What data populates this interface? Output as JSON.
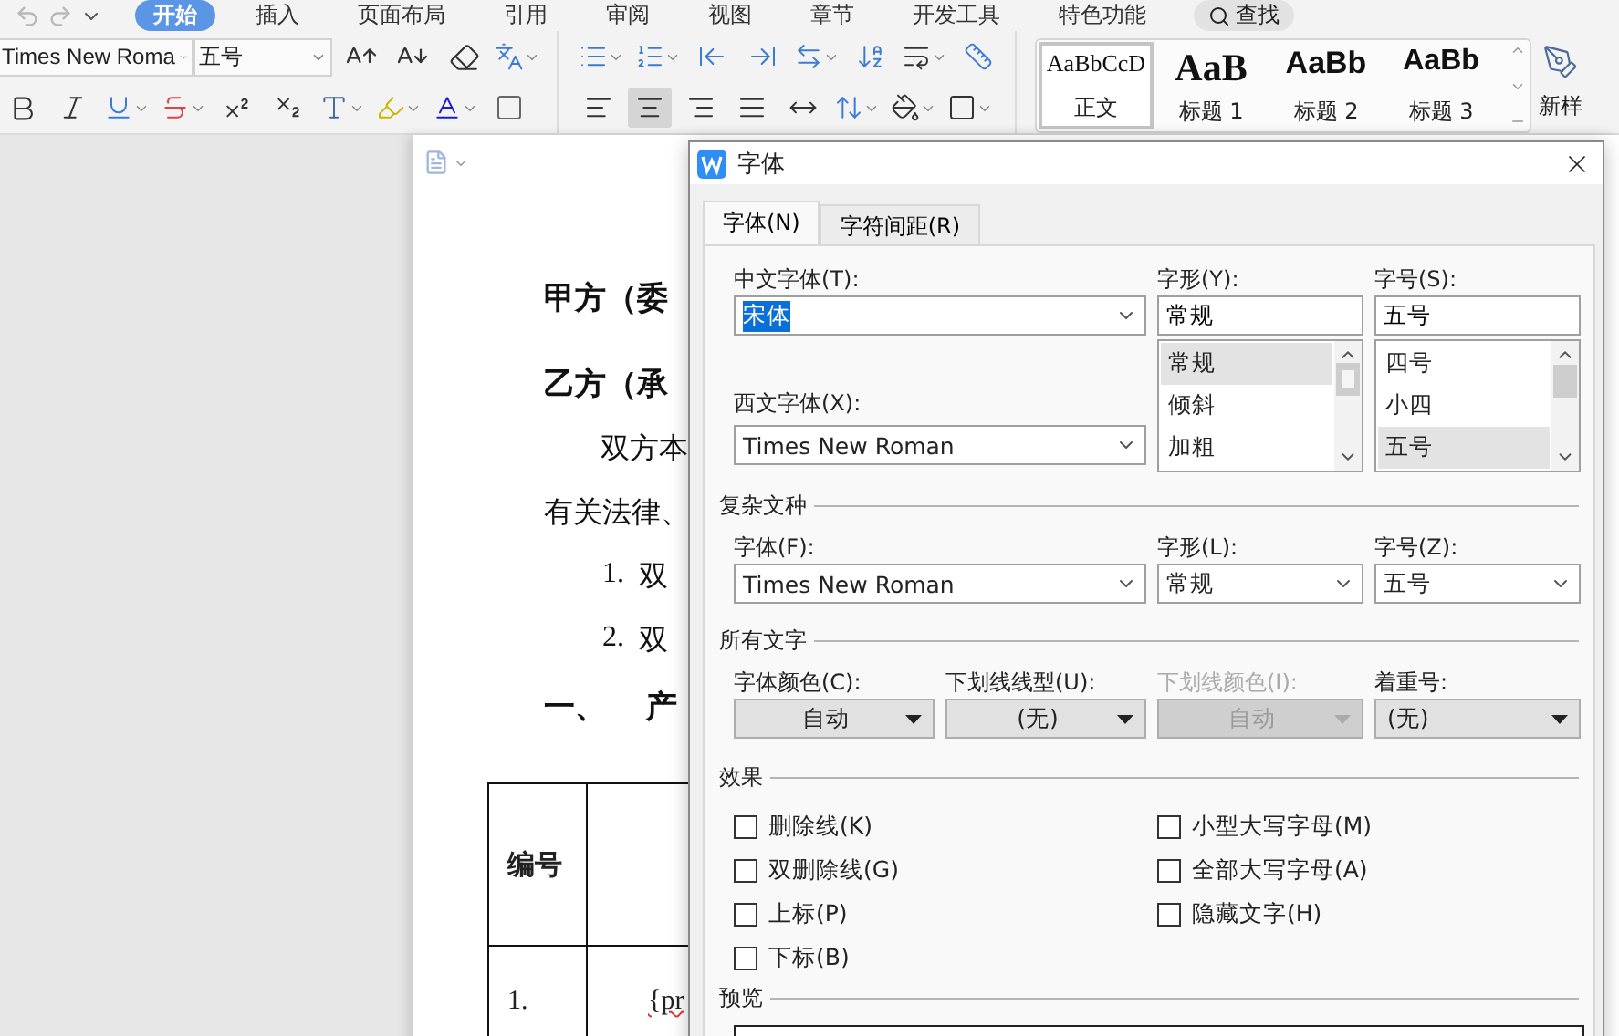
{
  "ribbon_tabs": [
    {
      "label": "开始",
      "selected": true
    },
    {
      "label": "插入",
      "selected": false
    },
    {
      "label": "页面布局",
      "selected": false
    },
    {
      "label": "引用",
      "selected": false
    },
    {
      "label": "审阅",
      "selected": false
    },
    {
      "label": "视图",
      "selected": false
    },
    {
      "label": "章节",
      "selected": false
    },
    {
      "label": "开发工具",
      "selected": false
    },
    {
      "label": "特色功能",
      "selected": false
    }
  ],
  "search_button": {
    "label": "查找"
  },
  "font_toolbar": {
    "font_name": "Times New Roma",
    "font_size": "五号"
  },
  "align_buttons": [
    {
      "selected": false
    },
    {
      "selected": true
    },
    {
      "selected": false
    },
    {
      "selected": false
    },
    {
      "selected": false
    }
  ],
  "styles": [
    {
      "kind": "body",
      "preview": "AaBbCcD",
      "name": "正文",
      "selected": true
    },
    {
      "kind": "heading1",
      "preview": "AaB",
      "name": "标题 1",
      "selected": false
    },
    {
      "kind": "heading2",
      "preview": "AaBb",
      "name": "标题 2",
      "selected": false
    },
    {
      "kind": "heading3",
      "preview": "AaBb",
      "name": "标题 3",
      "selected": false
    }
  ],
  "new_style": {
    "label": "新样"
  },
  "document": {
    "paragraphs": [
      {
        "kind": "party",
        "text": "甲方（委"
      },
      {
        "kind": "party",
        "text": "乙方（承"
      },
      {
        "kind": "indented",
        "text": "双方本"
      },
      {
        "kind": "body",
        "text": "有关法律、"
      },
      {
        "kind": "numbered",
        "number": "1.",
        "text": "双"
      },
      {
        "kind": "numbered",
        "number": "2.",
        "text": "双"
      },
      {
        "kind": "heading",
        "number": "一、",
        "text": "产"
      }
    ],
    "table": {
      "header": [
        "编号"
      ],
      "rows": [
        [
          "1.",
          "{pr"
        ]
      ]
    }
  },
  "dialog": {
    "title": "字体",
    "tabs": [
      {
        "label": "字体(N)",
        "selected": true
      },
      {
        "label": "字符间距(R)",
        "selected": false
      }
    ],
    "chinese_font": {
      "label": "中文字体(T):",
      "value": "宋体",
      "value_selected": true
    },
    "style": {
      "label": "字形(Y):",
      "value": "常规",
      "options": [
        {
          "label": "常规",
          "selected": true
        },
        {
          "label": "倾斜",
          "selected": false
        },
        {
          "label": "加粗",
          "selected": false
        }
      ]
    },
    "size": {
      "label": "字号(S):",
      "value": "五号",
      "options": [
        {
          "label": "四号",
          "selected": false
        },
        {
          "label": "小四",
          "selected": false
        },
        {
          "label": "五号",
          "selected": true
        }
      ]
    },
    "western_font": {
      "label": "西文字体(X):",
      "value": "Times New Roman"
    },
    "complex_script": {
      "title": "复杂文种",
      "fields": [
        {
          "label": "字体(F):",
          "value": "Times New Roman"
        },
        {
          "label": "字形(L):",
          "value": "常规"
        },
        {
          "label": "字号(Z):",
          "value": "五号"
        }
      ]
    },
    "all_text": {
      "title": "所有文字",
      "fields": [
        {
          "label": "字体颜色(C):",
          "value": "自动",
          "disabled": false
        },
        {
          "label": "下划线线型(U):",
          "value": "(无)",
          "disabled": false
        },
        {
          "label": "下划线颜色(I):",
          "value": "自动",
          "disabled": true
        },
        {
          "label": "着重号:",
          "value": "(无)",
          "disabled": false
        }
      ]
    },
    "effects": {
      "title": "效果",
      "left": [
        {
          "label": "删除线(K)",
          "checked": false
        },
        {
          "label": "双删除线(G)",
          "checked": false
        },
        {
          "label": "上标(P)",
          "checked": false
        },
        {
          "label": "下标(B)",
          "checked": false
        }
      ],
      "right": [
        {
          "label": "小型大写字母(M)",
          "checked": false
        },
        {
          "label": "全部大写字母(A)",
          "checked": false
        },
        {
          "label": "隐藏文字(H)",
          "checked": false
        }
      ]
    },
    "preview": {
      "title": "预览"
    }
  }
}
